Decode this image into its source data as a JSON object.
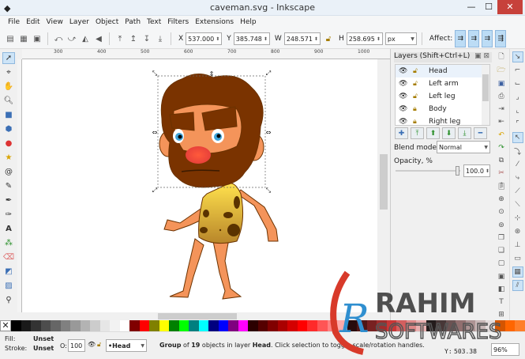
{
  "window": {
    "title": "caveman.svg - Inkscape",
    "minimize": "—",
    "maximize": "☐",
    "close": "✕"
  },
  "menu": [
    "File",
    "Edit",
    "View",
    "Layer",
    "Object",
    "Path",
    "Text",
    "Filters",
    "Extensions",
    "Help"
  ],
  "toolbar": {
    "x_label": "X",
    "x": "537.000",
    "y_label": "Y",
    "y": "385.748",
    "w_label": "W",
    "w": "248.571",
    "h_label": "H",
    "h": "258.695",
    "unit": "px",
    "affect_label": "Affect:"
  },
  "ruler": [
    "300",
    "400",
    "500",
    "600",
    "700",
    "800",
    "900",
    "1000"
  ],
  "layers_panel": {
    "title": "Layers (Shift+Ctrl+L)",
    "layers": [
      {
        "name": "Head",
        "locked": false
      },
      {
        "name": "Left arm",
        "locked": false
      },
      {
        "name": "Left leg",
        "locked": false
      },
      {
        "name": "Body",
        "locked": true
      },
      {
        "name": "Right leg",
        "locked": true
      }
    ],
    "blend_label": "Blend mode:",
    "blend_value": "Normal",
    "opacity_label": "Opacity, %",
    "opacity_value": "100.0",
    "opacity": 100
  },
  "palette": [
    "#000000",
    "#1a1a1a",
    "#333333",
    "#4d4d4d",
    "#666666",
    "#808080",
    "#999999",
    "#b3b3b3",
    "#cccccc",
    "#e6e6e6",
    "#f2f2f2",
    "#ffffff",
    "#800000",
    "#ff0000",
    "#808000",
    "#ffff00",
    "#008000",
    "#00ff00",
    "#008080",
    "#00ffff",
    "#000080",
    "#0000ff",
    "#800080",
    "#ff00ff",
    "#2b0000",
    "#550000",
    "#800000",
    "#aa0000",
    "#d40000",
    "#ff0000",
    "#ff2a2a",
    "#ff5555",
    "#ff8080",
    "#ffaaaa",
    "#280b0b",
    "#501616",
    "#782121",
    "#a02c2c",
    "#c83737",
    "#d35f5f",
    "#de8787",
    "#e9afaf",
    "#241c1c",
    "#483737",
    "#6c5353",
    "#916f6f",
    "#ac9393",
    "#c8b7b7",
    "#e3dbdb",
    "#d45500",
    "#ff6600",
    "#ff7f2a"
  ],
  "status": {
    "fill_label": "Fill:",
    "fill_value": "Unset",
    "stroke_label": "Stroke:",
    "stroke_value": "Unset",
    "opacity_label": "O:",
    "opacity_value": "100",
    "layer": "•Head",
    "message_pre": "Group",
    "message_of": " of ",
    "count": "19",
    "message_mid": " objects in layer ",
    "layer_name": "Head",
    "message_post": ". Click selection to toggle scale/rotation handles.",
    "y_label": "Y:",
    "y_value": "503.38",
    "zoom": "96%"
  },
  "watermark": "RAHIM SOFTWARES"
}
